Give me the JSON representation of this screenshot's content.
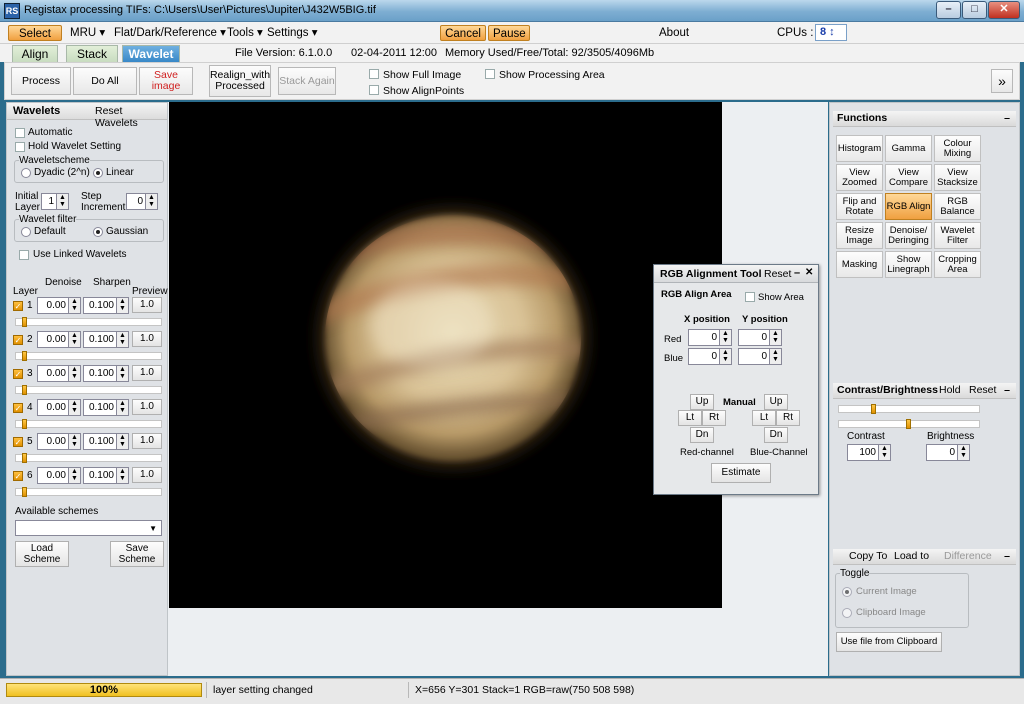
{
  "window": {
    "title": "Registax processing TIFs: C:\\Users\\User\\Pictures\\Jupiter\\J432W5BIG.tif",
    "icon": "RS"
  },
  "menubar": {
    "select": "Select",
    "mru": "MRU ▾",
    "flat": "Flat/Dark/Reference ▾",
    "tools": "Tools ▾",
    "settings": "Settings ▾",
    "cancel": "Cancel",
    "pause": "Pause",
    "about": "About",
    "cpus_label": "CPUs :",
    "cpus_value": "8 ↕"
  },
  "tabs": {
    "align": "Align",
    "stack": "Stack",
    "wavelet": "Wavelet",
    "file_version": "File Version: 6.1.0.0",
    "date": "02-04-2011 12:00",
    "memory": "Memory Used/Free/Total: 92/3505/4096Mb"
  },
  "toolbar": {
    "process": "Process",
    "do_all": "Do All",
    "save_image": "Save image",
    "realign": "Realign_with Processed",
    "stack_again": "Stack Again",
    "show_full_image": "Show Full Image",
    "show_alignpoints": "Show AlignPoints",
    "show_processing_area": "Show Processing Area",
    "expand": "»"
  },
  "wavelets": {
    "title": "Wavelets",
    "reset": "Reset Wavelets",
    "automatic": "Automatic",
    "hold_setting": "Hold Wavelet Setting",
    "scheme_legend": "Waveletscheme",
    "dyadic": "Dyadic (2^n)",
    "linear": "Linear",
    "initial_layer_label": "Initial Layer",
    "initial_layer": "1",
    "step_label": "Step Increment",
    "step": "0",
    "filter_legend": "Wavelet filter",
    "filter_default": "Default",
    "filter_gaussian": "Gaussian",
    "use_linked": "Use Linked Wavelets",
    "col_layer": "Layer",
    "col_denoise": "Denoise",
    "col_sharpen": "Sharpen",
    "col_preview": "Preview",
    "layers": [
      {
        "num": "1",
        "denoise": "0.00",
        "sharpen": "0.100",
        "preview": "1.0"
      },
      {
        "num": "2",
        "denoise": "0.00",
        "sharpen": "0.100",
        "preview": "1.0"
      },
      {
        "num": "3",
        "denoise": "0.00",
        "sharpen": "0.100",
        "preview": "1.0"
      },
      {
        "num": "4",
        "denoise": "0.00",
        "sharpen": "0.100",
        "preview": "1.0"
      },
      {
        "num": "5",
        "denoise": "0.00",
        "sharpen": "0.100",
        "preview": "1.0"
      },
      {
        "num": "6",
        "denoise": "0.00",
        "sharpen": "0.100",
        "preview": "1.0"
      }
    ],
    "available_schemes": "Available schemes",
    "load_scheme": "Load Scheme",
    "save_scheme": "Save Scheme"
  },
  "rgb_tool": {
    "title": "RGB Alignment Tool",
    "reset": "Reset",
    "minimize": "–",
    "close": "✕",
    "align_area": "RGB Align Area",
    "show_area": "Show Area",
    "x_position": "X position",
    "y_position": "Y position",
    "red": "Red",
    "blue": "Blue",
    "red_x": "0",
    "red_y": "0",
    "blue_x": "0",
    "blue_y": "0",
    "manual": "Manual",
    "up": "Up",
    "lt": "Lt",
    "rt": "Rt",
    "dn": "Dn",
    "red_channel": "Red-channel",
    "blue_channel": "Blue-Channel",
    "estimate": "Estimate"
  },
  "functions": {
    "title": "Functions",
    "collapse": "–",
    "buttons": [
      "Histogram",
      "Gamma",
      "Colour Mixing",
      "View Zoomed",
      "View Compare",
      "View Stacksize",
      "Flip and Rotate",
      "RGB Align",
      "RGB Balance",
      "Resize Image",
      "Denoise/ Deringing",
      "Wavelet Filter",
      "Masking",
      "Show Linegraph",
      "Cropping Area"
    ]
  },
  "contrast": {
    "title": "Contrast/Brightness",
    "hold": "Hold",
    "reset": "Reset",
    "collapse": "–",
    "contrast_label": "Contrast",
    "contrast_value": "100",
    "brightness_label": "Brightness",
    "brightness_value": "0"
  },
  "clipboard": {
    "copy_to": "Copy To",
    "load_to": "Load to",
    "difference": "Difference",
    "collapse": "–",
    "toggle": "Toggle",
    "current_image": "Current Image",
    "clipboard_image": "Clipboard Image",
    "use_file": "Use file from Clipboard"
  },
  "status": {
    "progress": "100%",
    "message": "layer setting changed",
    "readout": "X=656 Y=301 Stack=1 RGB=raw(750 508 598)"
  },
  "colors": {
    "accent_orange": "#f0a040",
    "wavelet_tab_blue": "#3888c8",
    "save_red": "#d02020"
  }
}
